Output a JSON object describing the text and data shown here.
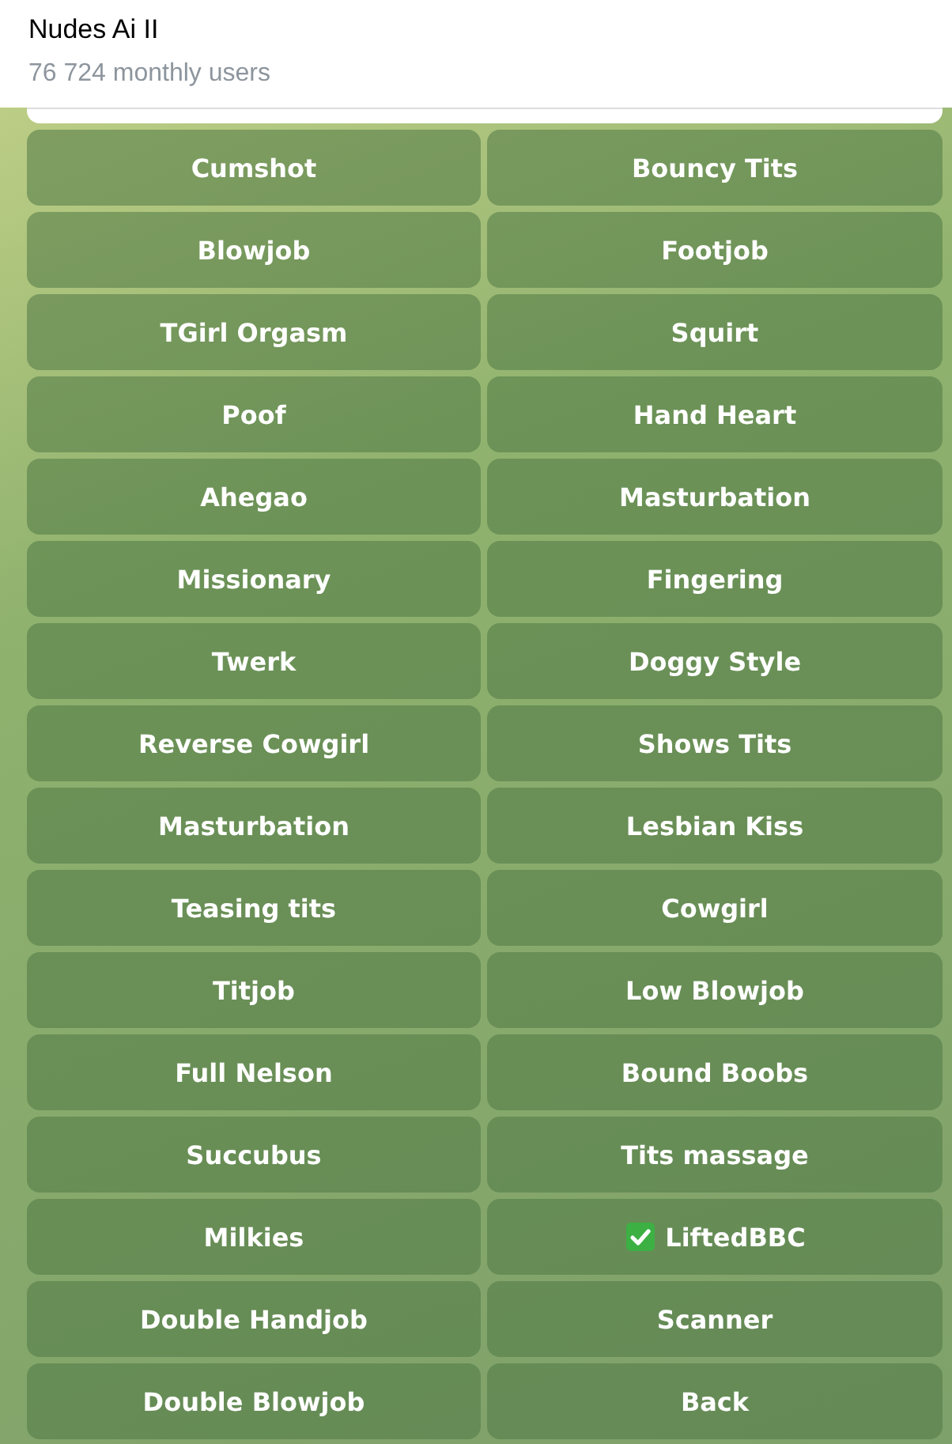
{
  "header": {
    "title": "Nudes Ai II",
    "subtitle": "76 724 monthly users"
  },
  "keyboard": [
    {
      "label": "Cumshot",
      "selected": false
    },
    {
      "label": "Bouncy Tits",
      "selected": false
    },
    {
      "label": "Blowjob",
      "selected": false
    },
    {
      "label": "Footjob",
      "selected": false
    },
    {
      "label": "TGirl Orgasm",
      "selected": false
    },
    {
      "label": "Squirt",
      "selected": false
    },
    {
      "label": "Poof",
      "selected": false
    },
    {
      "label": "Hand Heart",
      "selected": false
    },
    {
      "label": "Ahegao",
      "selected": false
    },
    {
      "label": "Masturbation",
      "selected": false
    },
    {
      "label": "Missionary",
      "selected": false
    },
    {
      "label": "Fingering",
      "selected": false
    },
    {
      "label": "Twerk",
      "selected": false
    },
    {
      "label": "Doggy Style",
      "selected": false
    },
    {
      "label": "Reverse Cowgirl",
      "selected": false
    },
    {
      "label": "Shows Tits",
      "selected": false
    },
    {
      "label": "Masturbation",
      "selected": false
    },
    {
      "label": "Lesbian Kiss",
      "selected": false
    },
    {
      "label": "Teasing tits",
      "selected": false
    },
    {
      "label": "Cowgirl",
      "selected": false
    },
    {
      "label": "Titjob",
      "selected": false
    },
    {
      "label": "Low Blowjob",
      "selected": false
    },
    {
      "label": "Full Nelson",
      "selected": false
    },
    {
      "label": "Bound Boobs",
      "selected": false
    },
    {
      "label": "Succubus",
      "selected": false
    },
    {
      "label": "Tits massage",
      "selected": false
    },
    {
      "label": "Milkies",
      "selected": false
    },
    {
      "label": "LiftedBBC",
      "selected": true
    },
    {
      "label": "Double Handjob",
      "selected": false
    },
    {
      "label": "Scanner",
      "selected": false
    },
    {
      "label": "Double Blowjob",
      "selected": false
    },
    {
      "label": "Back",
      "selected": false
    }
  ]
}
